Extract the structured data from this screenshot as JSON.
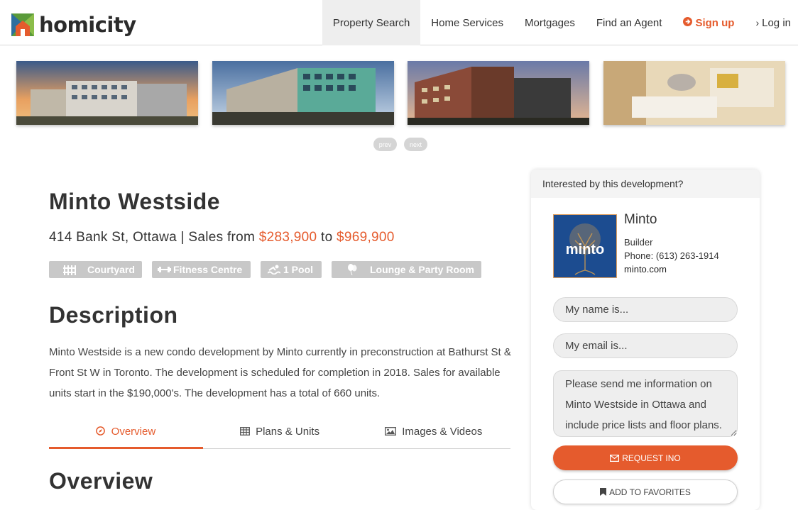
{
  "brand": {
    "name": "homicity",
    "accent": "#e55b2d"
  },
  "nav": {
    "items": [
      {
        "label": "Property Search",
        "active": true
      },
      {
        "label": "Home Services"
      },
      {
        "label": "Mortgages"
      },
      {
        "label": "Find an Agent"
      }
    ],
    "signup_label": "Sign up",
    "login_label": "Log in"
  },
  "gallery": {
    "images": [
      "building-rendering",
      "building-rendering",
      "building-rendering",
      "interior-rendering"
    ],
    "prev_label": "prev",
    "next_label": "next"
  },
  "listing": {
    "title": "Minto Westside",
    "address": "414 Bank St, Ottawa",
    "sales_prefix": " | Sales from ",
    "price_from": "$283,900",
    "price_sep": " to ",
    "price_to": "$969,900",
    "amenities": [
      {
        "label": "Courtyard",
        "icon": "courtyard-icon"
      },
      {
        "label": "Fitness Centre",
        "icon": "dumbbell-icon"
      },
      {
        "label": "1 Pool",
        "icon": "swimmer-icon"
      },
      {
        "label": "Lounge & Party Room",
        "icon": "balloon-icon"
      }
    ],
    "description_heading": "Description",
    "description": "Minto Westside is a new condo development by Minto currently in preconstruction at Bathurst St & Front St W in Toronto. The development is scheduled for completion in 2018. Sales for available units start in the $190,000's. The development has a total of 660 units.",
    "tabs": [
      {
        "label": "Overview",
        "icon": "compass-icon",
        "active": true
      },
      {
        "label": "Plans & Units",
        "icon": "table-icon"
      },
      {
        "label": "Images & Videos",
        "icon": "image-icon"
      }
    ],
    "overview_heading": "Overview"
  },
  "sidebar": {
    "heading": "Interested by this development?",
    "builder": {
      "name": "Minto",
      "role": "Builder",
      "phone": "Phone: (613) 263-1914",
      "website": "minto.com",
      "logo_text": "minto"
    },
    "form": {
      "name_placeholder": "My name is...",
      "email_placeholder": "My email is...",
      "message": "Please send me information on Minto Westside in Ottawa and include price lists and floor plans.",
      "request_label": "REQUEST INO",
      "favorites_label": "ADD TO FAVORITES"
    }
  }
}
